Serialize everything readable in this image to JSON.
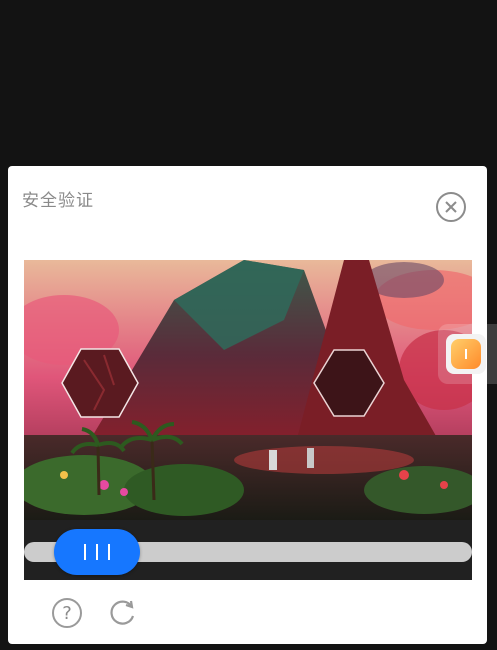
{
  "dialog": {
    "title": "安全验证"
  },
  "icons": {
    "close": "close-icon",
    "help": "help-icon",
    "refresh": "refresh-icon",
    "slider_grip": "grip-icon",
    "side_assist": "assistive-touch-icon"
  },
  "slider": {
    "progress_fraction": 0.12,
    "handle_color": "#1677ff",
    "track_color": "#cccccc"
  },
  "help": {
    "glyph": "?"
  },
  "colors": {
    "page_background": "#131313",
    "dialog_background": "#ffffff",
    "title_color": "#8a8a8a"
  }
}
